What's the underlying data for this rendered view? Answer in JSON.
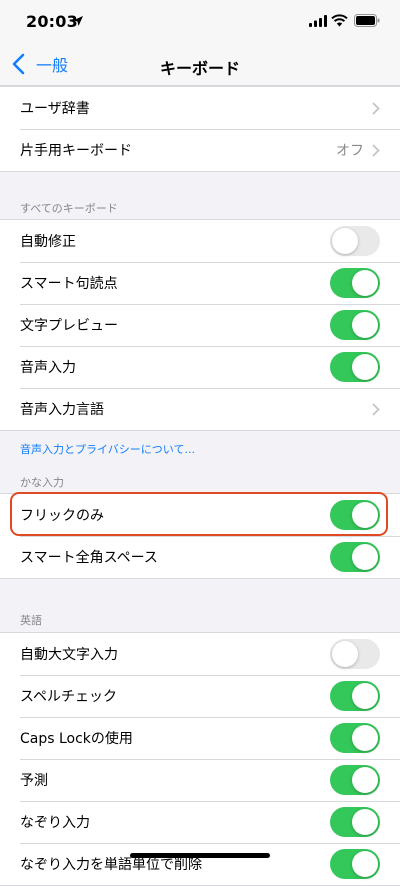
{
  "status": {
    "time": "20:03"
  },
  "nav": {
    "back_label": "一般",
    "title": "キーボード"
  },
  "group1": [
    {
      "label": "ユーザ辞書",
      "value": ""
    },
    {
      "label": "片手用キーボード",
      "value": "オフ"
    }
  ],
  "all_keyboards": {
    "header": "すべてのキーボード",
    "rows": [
      {
        "label": "自動修正",
        "toggle": "off"
      },
      {
        "label": "スマート句読点",
        "toggle": "on"
      },
      {
        "label": "文字プレビュー",
        "toggle": "on"
      },
      {
        "label": "音声入力",
        "toggle": "on"
      },
      {
        "label": "音声入力言語"
      }
    ],
    "footer_link": "音声入力とプライバシーについて..."
  },
  "kana": {
    "header": "かな入力",
    "rows": [
      {
        "label": "フリックのみ",
        "toggle": "on"
      },
      {
        "label": "スマート全角スペース",
        "toggle": "on"
      }
    ]
  },
  "english": {
    "header": "英語",
    "rows": [
      {
        "label": "自動大文字入力",
        "toggle": "off"
      },
      {
        "label": "スペルチェック",
        "toggle": "on"
      },
      {
        "label": "Caps Lockの使用",
        "toggle": "on"
      },
      {
        "label": "予測",
        "toggle": "on"
      },
      {
        "label": "なぞり入力",
        "toggle": "on"
      },
      {
        "label": "なぞり入力を単語単位で削除",
        "toggle": "on"
      }
    ]
  },
  "colors": {
    "accent": "#147efb",
    "toggle_on": "#34c759",
    "toggle_off": "#e9e9ea",
    "highlight": "#e04a22"
  },
  "icons": [
    "location-arrow-icon",
    "signal-icon",
    "wifi-icon",
    "battery-icon",
    "back-chevron-icon",
    "chevron-right-icon"
  ]
}
